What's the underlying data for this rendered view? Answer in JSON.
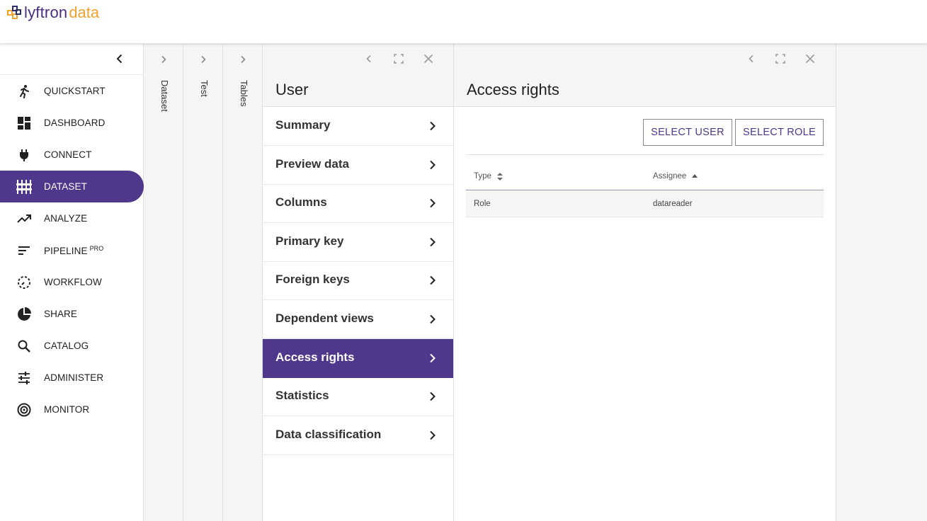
{
  "brand": {
    "name_part1": "lyftron",
    "name_part2": "data"
  },
  "sidebar": {
    "items": [
      {
        "label": "QUICKSTART",
        "icon": "run-icon"
      },
      {
        "label": "DASHBOARD",
        "icon": "dashboard-icon"
      },
      {
        "label": "CONNECT",
        "icon": "plug-icon"
      },
      {
        "label": "DATASET",
        "icon": "dataset-icon",
        "active": true
      },
      {
        "label": "ANALYZE",
        "icon": "trending-up-icon"
      },
      {
        "label": "PIPELINE",
        "sup": "PRO",
        "icon": "pipeline-icon"
      },
      {
        "label": "WORKFLOW",
        "icon": "workflow-icon"
      },
      {
        "label": "SHARE",
        "icon": "pie-icon"
      },
      {
        "label": "CATALOG",
        "icon": "search-icon"
      },
      {
        "label": "ADMINISTER",
        "icon": "sliders-icon"
      },
      {
        "label": "MONITOR",
        "icon": "radar-icon"
      }
    ]
  },
  "breadcrumbs": [
    {
      "label": "Dataset"
    },
    {
      "label": "Test"
    },
    {
      "label": "Tables"
    }
  ],
  "user_panel": {
    "title": "User",
    "items": [
      {
        "label": "Summary"
      },
      {
        "label": "Preview data"
      },
      {
        "label": "Columns"
      },
      {
        "label": "Primary key"
      },
      {
        "label": "Foreign keys"
      },
      {
        "label": "Dependent views"
      },
      {
        "label": "Access rights",
        "active": true
      },
      {
        "label": "Statistics"
      },
      {
        "label": "Data classification"
      }
    ]
  },
  "access_panel": {
    "title": "Access rights",
    "select_user_label": "SELECT USER",
    "select_role_label": "SELECT ROLE",
    "columns": {
      "type": "Type",
      "assignee": "Assignee"
    },
    "rows": [
      {
        "type": "Role",
        "assignee": "datareader"
      }
    ]
  },
  "colors": {
    "accent": "#4f378b",
    "logo_orange": "#f2a12e",
    "panel_gray": "#f5f5f5"
  }
}
